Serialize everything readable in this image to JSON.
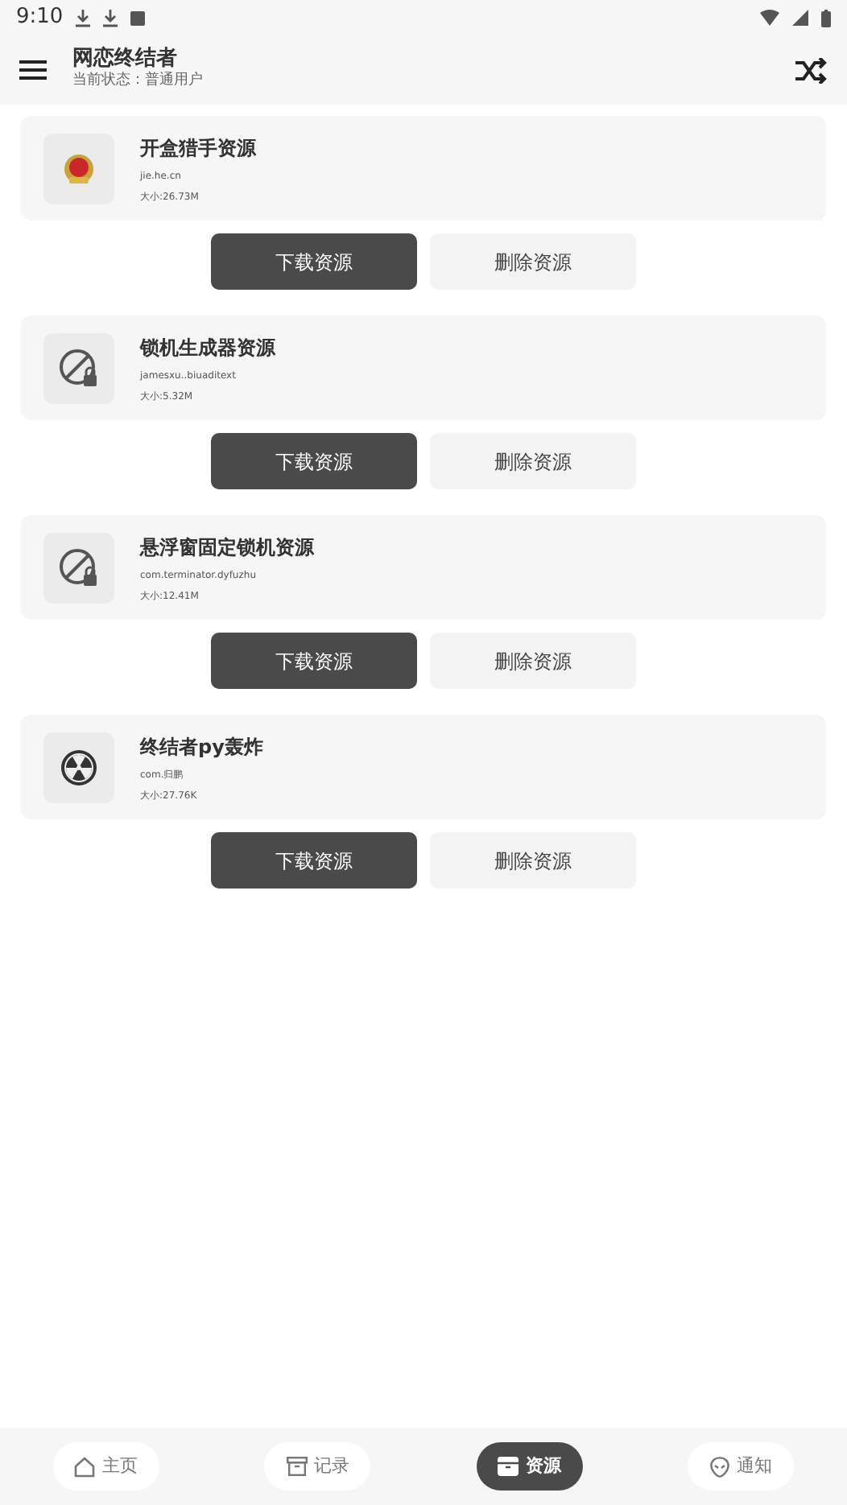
{
  "status_bar": {
    "time": "9:10"
  },
  "app_bar": {
    "title": "网恋终结者",
    "subtitle": "当前状态：普通用户"
  },
  "resources": [
    {
      "kind": "emblem",
      "name": "开盒猎手资源",
      "package": "jie.he.cn",
      "size": "大小:26.73M",
      "download": "下载资源",
      "delete": "删除资源"
    },
    {
      "kind": "lock",
      "name": "锁机生成器资源",
      "package": "jamesxu..biuaditext",
      "size": "大小:5.32M",
      "download": "下载资源",
      "delete": "删除资源"
    },
    {
      "kind": "lock",
      "name": "悬浮窗固定锁机资源",
      "package": "com.terminator.dyfuzhu",
      "size": "大小:12.41M",
      "download": "下载资源",
      "delete": "删除资源"
    },
    {
      "kind": "radiation",
      "name": "终结者py轰炸",
      "package": "com.归鹏",
      "size": "大小:27.76K",
      "download": "下载资源",
      "delete": "删除资源"
    }
  ],
  "bottom_nav": [
    {
      "kind": "home",
      "label": "主页",
      "selected": false
    },
    {
      "kind": "archive",
      "label": "记录",
      "selected": false
    },
    {
      "kind": "box",
      "label": "资源",
      "selected": true
    },
    {
      "kind": "alien",
      "label": "通知",
      "selected": false
    }
  ]
}
